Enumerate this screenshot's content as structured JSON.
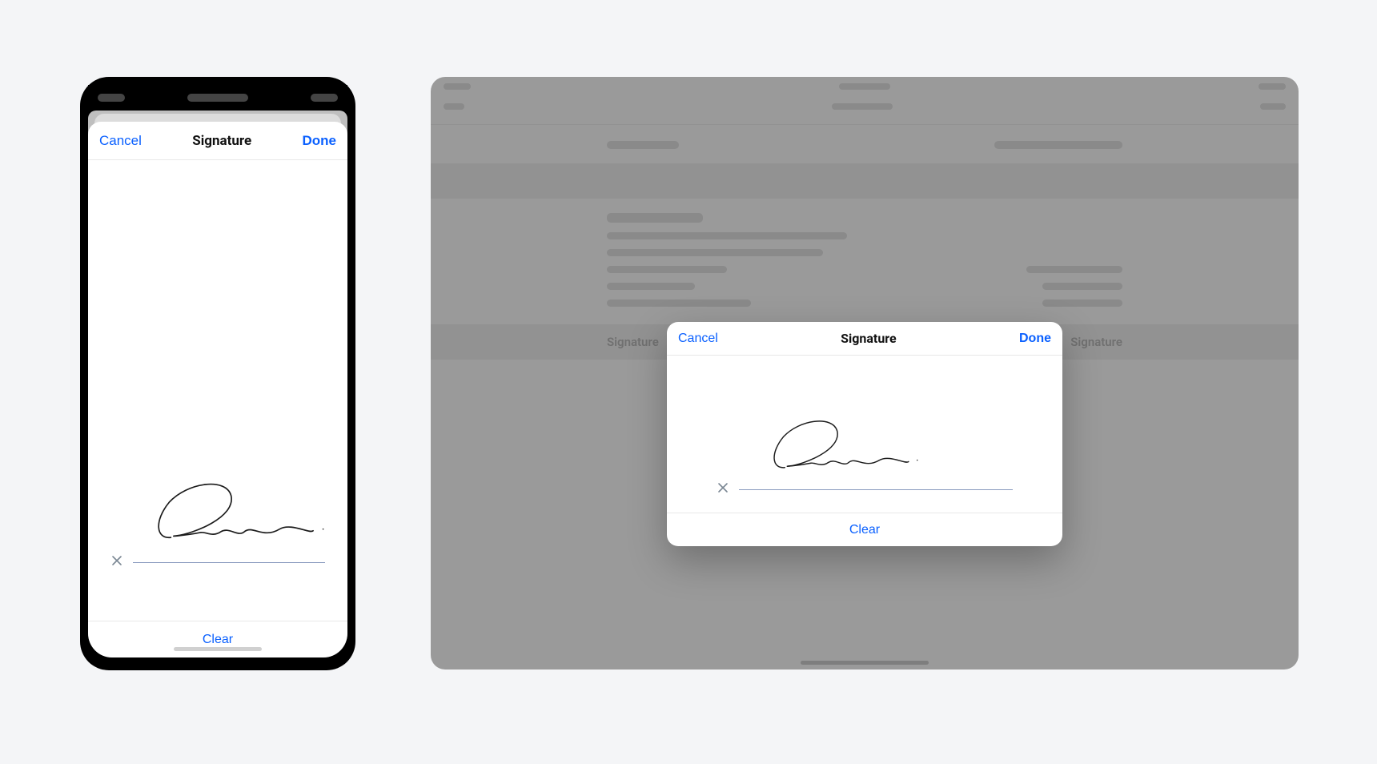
{
  "colors": {
    "tint": "#0a60ff",
    "sig_line": "#8a9bbf",
    "icon_gray": "#7b8794"
  },
  "phone": {
    "nav": {
      "cancel": "Cancel",
      "title": "Signature",
      "done": "Done"
    },
    "clear": "Clear"
  },
  "tablet": {
    "sig_label_left": "Signature",
    "sig_label_right": "Signature",
    "modal": {
      "cancel": "Cancel",
      "title": "Signature",
      "done": "Done",
      "clear": "Clear"
    }
  }
}
